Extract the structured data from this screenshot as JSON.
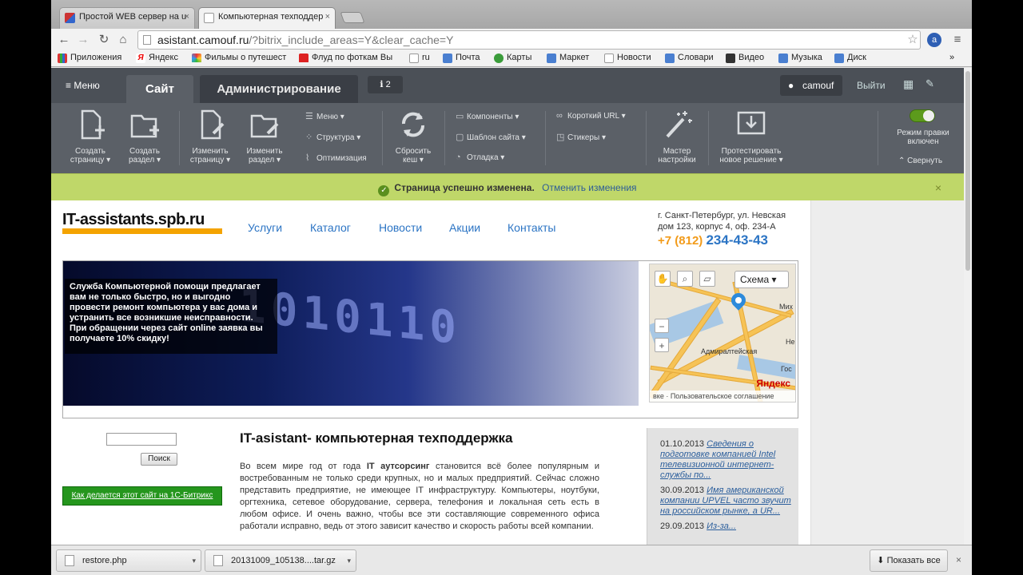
{
  "browser": {
    "tabs": [
      {
        "title": "Простой WEB сервер на u",
        "close": "×"
      },
      {
        "title": "Компьютерная техподдер",
        "close": "×"
      }
    ],
    "url_host": "asistant.camouf.ru",
    "url_path": "/?bitrix_include_areas=Y&clear_cache=Y",
    "bookmarks": [
      "Приложения",
      "Яндекс",
      "Фильмы о путешест",
      "Флуд по фоткам Вы",
      "ru",
      "Почта",
      "Карты",
      "Маркет",
      "Новости",
      "Словари",
      "Видео",
      "Музыка",
      "Диск"
    ],
    "bookmarks_more": "»"
  },
  "bitrix": {
    "menu": "Меню",
    "tab_site": "Сайт",
    "tab_admin": "Администрирование",
    "badge_count": "2",
    "user": "camouf",
    "exit": "Выйти",
    "buttons": [
      {
        "label1": "Создать",
        "label2": "страницу ▾"
      },
      {
        "label1": "Создать",
        "label2": "раздел ▾"
      },
      {
        "label1": "Изменить",
        "label2": "страницу ▾"
      },
      {
        "label1": "Изменить",
        "label2": "раздел ▾"
      },
      {
        "label1": "Сбросить",
        "label2": "кеш ▾"
      },
      {
        "label1": "Мастер",
        "label2": "настройки"
      },
      {
        "label1": "Протестировать",
        "label2": "новое решение ▾"
      }
    ],
    "list1": [
      "Меню ▾",
      "Структура ▾",
      "Оптимизация"
    ],
    "list2": [
      "Компоненты ▾",
      "Шаблон сайта ▾",
      "Отладка ▾"
    ],
    "list3": [
      "Короткий URL ▾",
      "Стикеры ▾"
    ],
    "edit_mode": "Режим правки",
    "edit_mode2": "включен",
    "collapse": "Свернуть"
  },
  "notice": {
    "text": "Страница успешно изменена.",
    "undo": "Отменить изменения",
    "close": "×"
  },
  "site": {
    "logo": "IT-assistants.spb.ru",
    "nav": [
      "Услуги",
      "Каталог",
      "Новости",
      "Акции",
      "Контакты"
    ],
    "address1": "г. Санкт-Петербург, ул. Невская",
    "address2": "дом 123, корпус 4, оф. 234-А",
    "phone_code": "+7 (812)",
    "phone_num": "234-43-43",
    "banner_digits": "1010110",
    "banner_caption": "Служба Компьютерной помощи предлагает вам не только быстро, но и выгодно провести ремонт компьютера у вас дома и устранить все возникшие неисправности. При обращении через сайт online заявка вы получаете 10% скидку!",
    "map": {
      "schema": "Схема ▾",
      "label_admiralty": "Адмиралтейская",
      "label_mikh": "Мих",
      "label_ne": "Не",
      "label_gos": "Гос",
      "yandex": "Яндекс",
      "footer": "вке · Пользовательское соглашение",
      "minus": "−",
      "plus": "+"
    },
    "search_button": "Поиск",
    "green_link": "Как делается этот сайт на 1С-Битрикс",
    "title": "IT-asistant- компьютерная техподдержка",
    "para_start": "Во всем мире год от года ",
    "para_bold": "IT аутсорсинг",
    "para_rest": " становится всё более популярным и востребованным не только среди крупных, но и малых предприятий. Сейчас сложно представить предприятие, не имеющее IT инфраструктуру. Компьютеры, ноутбуки, оргтехника, сетевое оборудование, сервера, телефония и локальная сеть есть в любом офисе. И очень важно, чтобы все эти составляющие современного офиса работали исправно, ведь от этого зависит качество и скорость работы всей компании.",
    "news": [
      {
        "date": "01.10.2013",
        "text": "Сведения о подготовке компанией Intel телевизионной интернет-службы по..."
      },
      {
        "date": "30.09.2013",
        "text": "Имя американской компании UPVEL часто звучит на российском рынке, а UR..."
      },
      {
        "date": "29.09.2013",
        "text": "Из-за..."
      }
    ]
  },
  "downloads": {
    "items": [
      "restore.php",
      "20131009_105138....tar.gz"
    ],
    "show_all": "Показать все",
    "close": "×"
  },
  "colors": {
    "accent_orange": "#f4a300",
    "link_blue": "#2b74c4",
    "notice_green": "#bfd769",
    "panel": "#5b6067"
  }
}
